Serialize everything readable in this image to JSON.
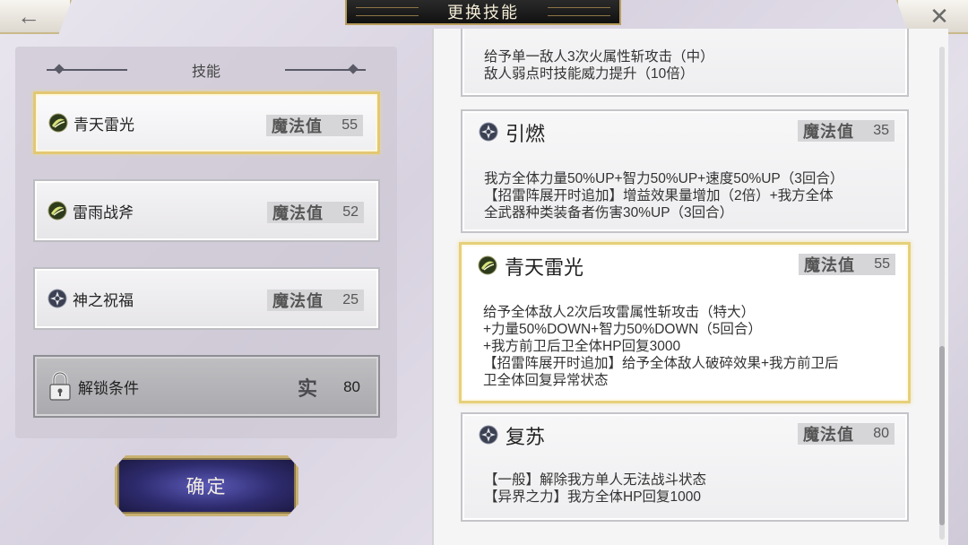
{
  "header": {
    "back_glyph": "←",
    "title": "更换技能",
    "close_glyph": "✕"
  },
  "left": {
    "section_title": "技能",
    "slots": [
      {
        "name": "青天雷光",
        "mp_label": "魔法值",
        "mp": "55",
        "icon": "thunder-orb-icon",
        "selected": true
      },
      {
        "name": "雷雨战斧",
        "mp_label": "魔法值",
        "mp": "52",
        "icon": "thunder-orb-icon",
        "selected": false
      },
      {
        "name": "神之祝福",
        "mp_label": "魔法值",
        "mp": "25",
        "icon": "support-gear-icon",
        "selected": false
      }
    ],
    "locked_slot": {
      "label": "解锁条件",
      "mark": "实",
      "value": "80",
      "icon": "padlock-icon"
    },
    "confirm_label": "确定"
  },
  "right": {
    "cards": [
      {
        "name": "",
        "mp_label": "",
        "mp": "",
        "desc": "给予单一敌人3次火属性斩攻击（中）\n敌人弱点时技能威力提升（10倍）",
        "partial": true
      },
      {
        "name": "引燃",
        "mp_label": "魔法值",
        "mp": "35",
        "icon": "support-gear-icon",
        "desc": "我方全体力量50%UP+智力50%UP+速度50%UP（3回合）\n【招雷阵展开时追加】增益效果量增加（2倍）+我方全体\n全武器种类装备者伤害30%UP（3回合）"
      },
      {
        "name": "青天雷光",
        "mp_label": "魔法值",
        "mp": "55",
        "icon": "thunder-orb-icon",
        "selected": true,
        "desc": "给予全体敌人2次后攻雷属性斩攻击（特大）\n+力量50%DOWN+智力50%DOWN（5回合）\n+我方前卫后卫全体HP回复3000\n【招雷阵展开时追加】给予全体敌人破碎效果+我方前卫后\n卫全体回复异常状态"
      },
      {
        "name": "复苏",
        "mp_label": "魔法值",
        "mp": "80",
        "icon": "support-gear-icon",
        "desc": "【一般】解除我方单人无法战斗状态\n【异界之力】我方全体HP回复1000"
      }
    ]
  },
  "colors": {
    "selected_border": "#e3c873",
    "confirm_bg": "#2e2b6e",
    "panel_bg": "#f5f5f6"
  }
}
